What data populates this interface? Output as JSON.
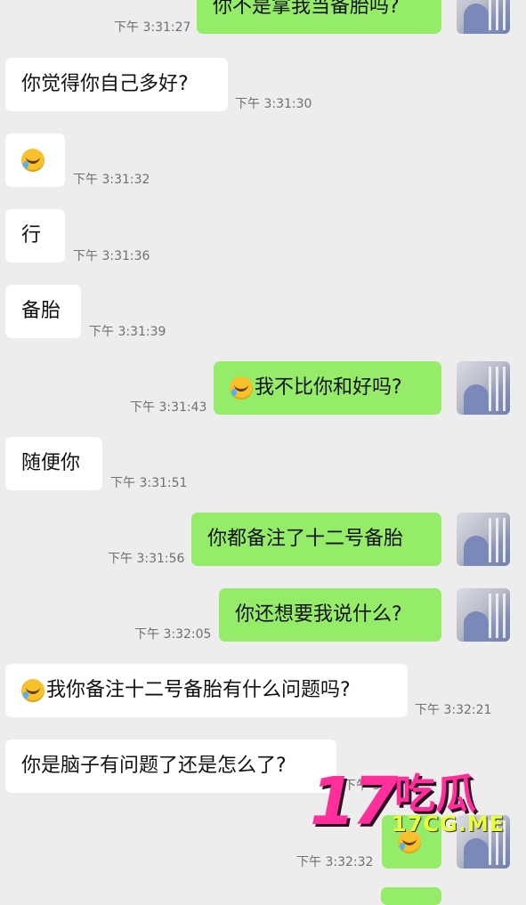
{
  "messages": [
    {
      "text": "你不是拿我当备胎吗?",
      "time": "下午 3:31:27"
    },
    {
      "text": "你觉得你自己多好?",
      "time": "下午 3:31:30"
    },
    {
      "text": "",
      "emoji": "laughing-crying-emoji",
      "time": "下午 3:31:32"
    },
    {
      "text": "行",
      "time": "下午 3:31:36"
    },
    {
      "text": "备胎",
      "time": "下午 3:31:39"
    },
    {
      "text": "我不比你和好吗?",
      "emoji": "laughing-crying-emoji",
      "time": "下午 3:31:43"
    },
    {
      "text": "随便你",
      "time": "下午 3:31:51"
    },
    {
      "text": "你都备注了十二号备胎",
      "time": "下午 3:31:56"
    },
    {
      "text": "你还想要我说什么?",
      "time": "下午 3:32:05"
    },
    {
      "text": "我你备注十二号备胎有什么问题吗?",
      "emoji": "laughing-crying-emoji",
      "time": "下午 3:32:21"
    },
    {
      "text": "你是脑子有问题了还是怎么了?",
      "time": "下午 3:32:2"
    },
    {
      "text": "",
      "emoji": "laughing-crying-emoji",
      "time": "下午 3:32:32"
    }
  ],
  "watermark": {
    "brand_num": "17",
    "brand_text": "吃瓜",
    "url": "17CG.ME"
  },
  "colors": {
    "background": "#ededed",
    "incoming": "#ffffff",
    "outgoing": "#95ec69",
    "watermark": "#ff2e9a"
  }
}
